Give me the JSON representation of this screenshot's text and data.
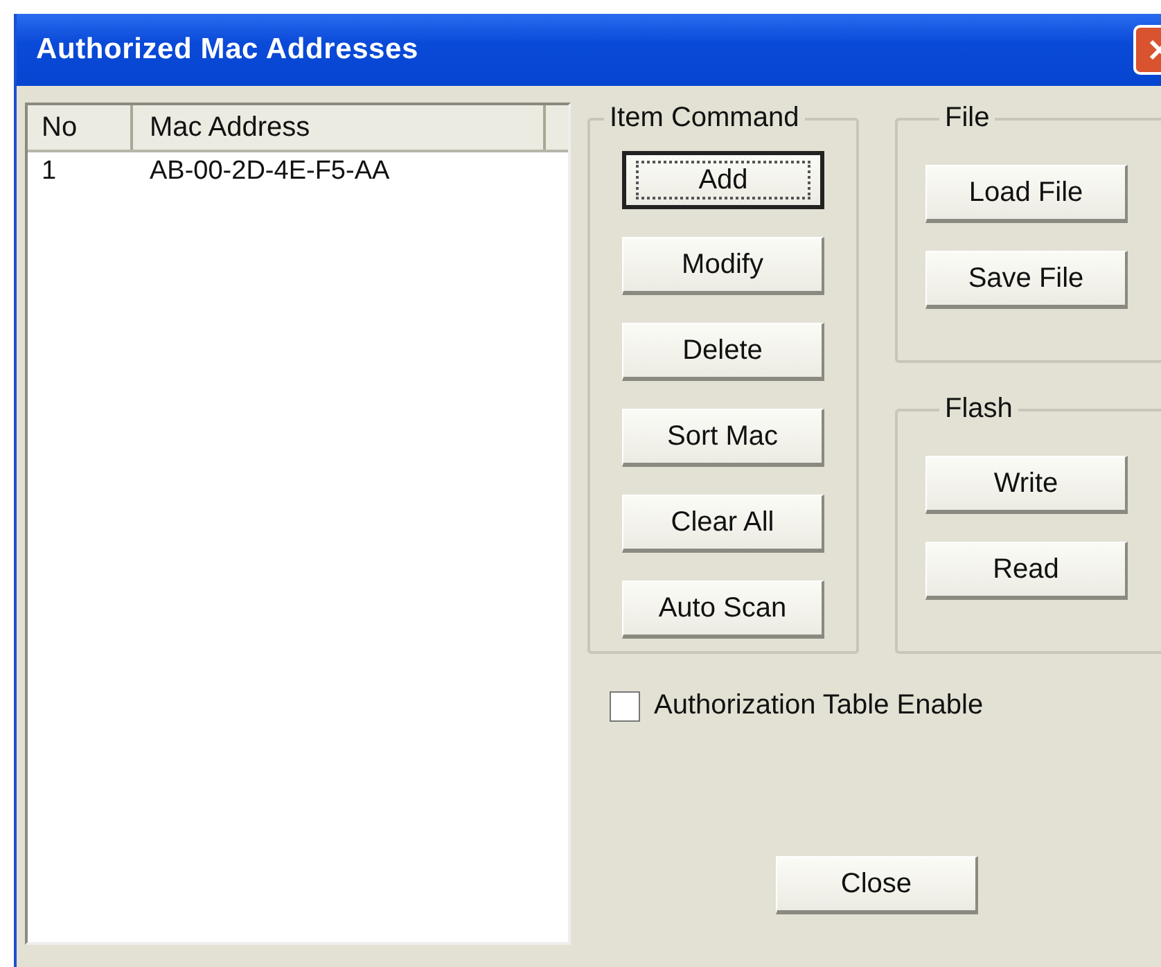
{
  "window": {
    "title": "Authorized Mac Addresses"
  },
  "table": {
    "columns": [
      "No",
      "Mac Address"
    ],
    "rows": [
      [
        "1",
        "AB-00-2D-4E-F5-AA"
      ]
    ]
  },
  "item_command": {
    "title": "Item Command",
    "buttons": [
      {
        "label": "Add",
        "focused": true
      },
      {
        "label": "Modify",
        "focused": false
      },
      {
        "label": "Delete",
        "focused": false
      },
      {
        "label": "Sort Mac",
        "focused": false
      },
      {
        "label": "Clear All",
        "focused": false
      },
      {
        "label": "Auto Scan",
        "focused": false
      }
    ]
  },
  "file": {
    "title": "File",
    "buttons": [
      "Load File",
      "Save File"
    ]
  },
  "flash": {
    "title": "Flash",
    "buttons": [
      "Write",
      "Read"
    ]
  },
  "checkbox": {
    "label": "Authorization Table Enable",
    "checked": false
  },
  "close_button": "Close"
}
